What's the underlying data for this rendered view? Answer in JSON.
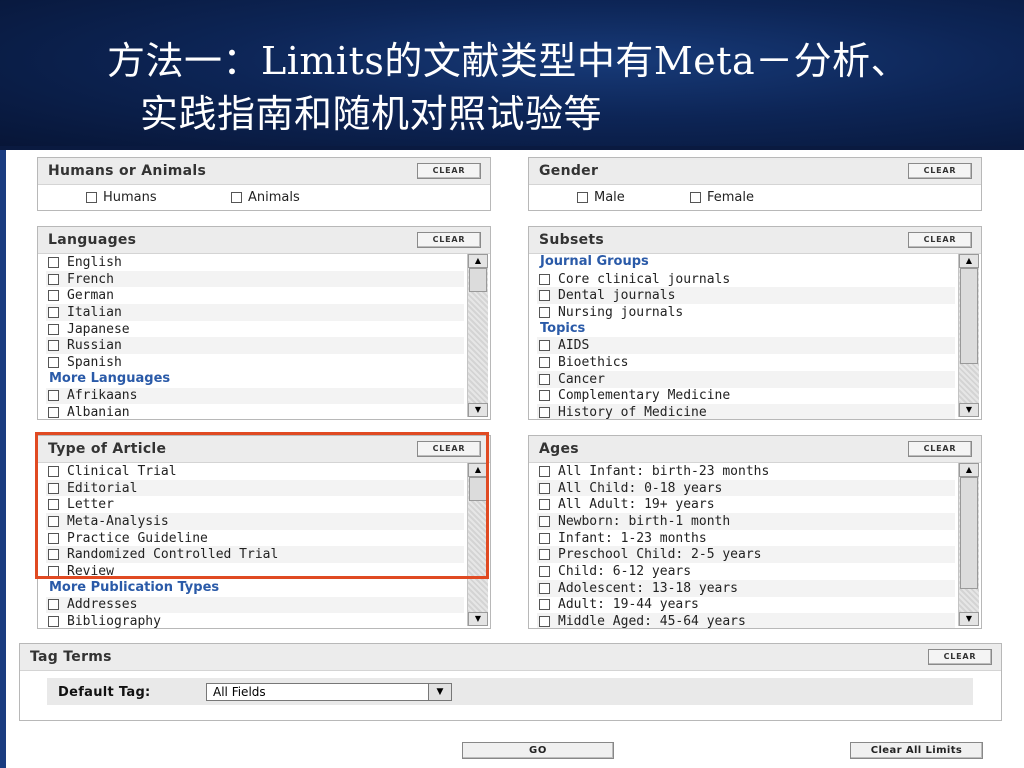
{
  "slide": {
    "title_line1": "方法一：Limits的文献类型中有Meta－分析、",
    "title_line2": "实践指南和随机对照试验等"
  },
  "clear_label": "CLEAR",
  "humans_animals": {
    "title": "Humans or Animals",
    "options": [
      "Humans",
      "Animals"
    ]
  },
  "gender": {
    "title": "Gender",
    "options": [
      "Male",
      "Female"
    ]
  },
  "languages": {
    "title": "Languages",
    "items": [
      {
        "type": "option",
        "label": "English"
      },
      {
        "type": "option",
        "label": "French"
      },
      {
        "type": "option",
        "label": "German"
      },
      {
        "type": "option",
        "label": "Italian"
      },
      {
        "type": "option",
        "label": "Japanese"
      },
      {
        "type": "option",
        "label": "Russian"
      },
      {
        "type": "option",
        "label": "Spanish"
      },
      {
        "type": "group",
        "label": "More Languages"
      },
      {
        "type": "option",
        "label": "Afrikaans"
      },
      {
        "type": "option",
        "label": "Albanian"
      }
    ]
  },
  "subsets": {
    "title": "Subsets",
    "items": [
      {
        "type": "group",
        "label": "Journal Groups"
      },
      {
        "type": "option",
        "label": "Core clinical journals"
      },
      {
        "type": "option",
        "label": "Dental journals"
      },
      {
        "type": "option",
        "label": "Nursing journals"
      },
      {
        "type": "group",
        "label": "Topics"
      },
      {
        "type": "option",
        "label": "AIDS"
      },
      {
        "type": "option",
        "label": "Bioethics"
      },
      {
        "type": "option",
        "label": "Cancer"
      },
      {
        "type": "option",
        "label": "Complementary Medicine"
      },
      {
        "type": "option",
        "label": "History of Medicine"
      }
    ]
  },
  "article_type": {
    "title": "Type of Article",
    "items": [
      {
        "type": "option",
        "label": "Clinical Trial"
      },
      {
        "type": "option",
        "label": "Editorial"
      },
      {
        "type": "option",
        "label": "Letter"
      },
      {
        "type": "option",
        "label": "Meta-Analysis"
      },
      {
        "type": "option",
        "label": "Practice Guideline"
      },
      {
        "type": "option",
        "label": "Randomized Controlled Trial"
      },
      {
        "type": "option",
        "label": "Review"
      },
      {
        "type": "group",
        "label": "More Publication Types"
      },
      {
        "type": "option",
        "label": "Addresses"
      },
      {
        "type": "option",
        "label": "Bibliography"
      }
    ]
  },
  "ages": {
    "title": "Ages",
    "items": [
      {
        "type": "option",
        "label": "All Infant: birth-23 months"
      },
      {
        "type": "option",
        "label": "All Child: 0-18 years"
      },
      {
        "type": "option",
        "label": "All Adult: 19+ years"
      },
      {
        "type": "option",
        "label": "Newborn: birth-1 month"
      },
      {
        "type": "option",
        "label": "Infant: 1-23 months"
      },
      {
        "type": "option",
        "label": "Preschool Child: 2-5 years"
      },
      {
        "type": "option",
        "label": "Child: 6-12 years"
      },
      {
        "type": "option",
        "label": "Adolescent: 13-18 years"
      },
      {
        "type": "option",
        "label": "Adult: 19-44 years"
      },
      {
        "type": "option",
        "label": "Middle Aged: 45-64 years"
      }
    ]
  },
  "tag_terms": {
    "title": "Tag Terms",
    "default_tag_label": "Default Tag:",
    "default_tag_value": "All Fields"
  },
  "buttons": {
    "go": "GO",
    "clear_all": "Clear All Limits"
  },
  "colors": {
    "header_bg": "#0d2556",
    "highlight": "#e04a22",
    "group_link": "#2a5aa8"
  }
}
